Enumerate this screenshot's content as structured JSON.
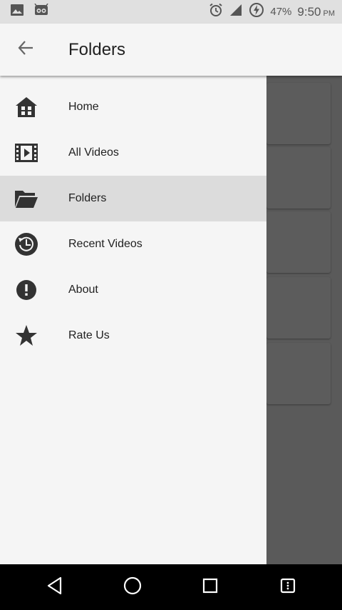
{
  "status_bar": {
    "battery": "47%",
    "time": "9:50",
    "ampm": "PM",
    "left_icons": [
      "image-icon",
      "android-debug-icon"
    ],
    "right_icons": [
      "alarm-icon",
      "signal-icon",
      "battery-charging-icon"
    ]
  },
  "header": {
    "title": "Folders",
    "back_icon": "arrow-back-icon"
  },
  "menu": {
    "items": [
      {
        "label": "Home",
        "icon": "home-icon",
        "selected": false
      },
      {
        "label": "All Videos",
        "icon": "video-film-icon",
        "selected": false
      },
      {
        "label": "Folders",
        "icon": "folder-open-icon",
        "selected": true
      },
      {
        "label": "Recent Videos",
        "icon": "history-clock-icon",
        "selected": false
      },
      {
        "label": "About",
        "icon": "info-alert-icon",
        "selected": false
      },
      {
        "label": "Rate Us",
        "icon": "star-icon",
        "selected": false
      }
    ]
  },
  "nav_bar": {
    "buttons": [
      "back-nav-icon",
      "home-nav-icon",
      "recents-nav-icon",
      "menu-nav-icon"
    ]
  },
  "colors": {
    "drawer_bg": "#f5f5f5",
    "selected_bg": "#dcdcdc",
    "scrim": "#5a5a5a",
    "icon": "#333333"
  }
}
